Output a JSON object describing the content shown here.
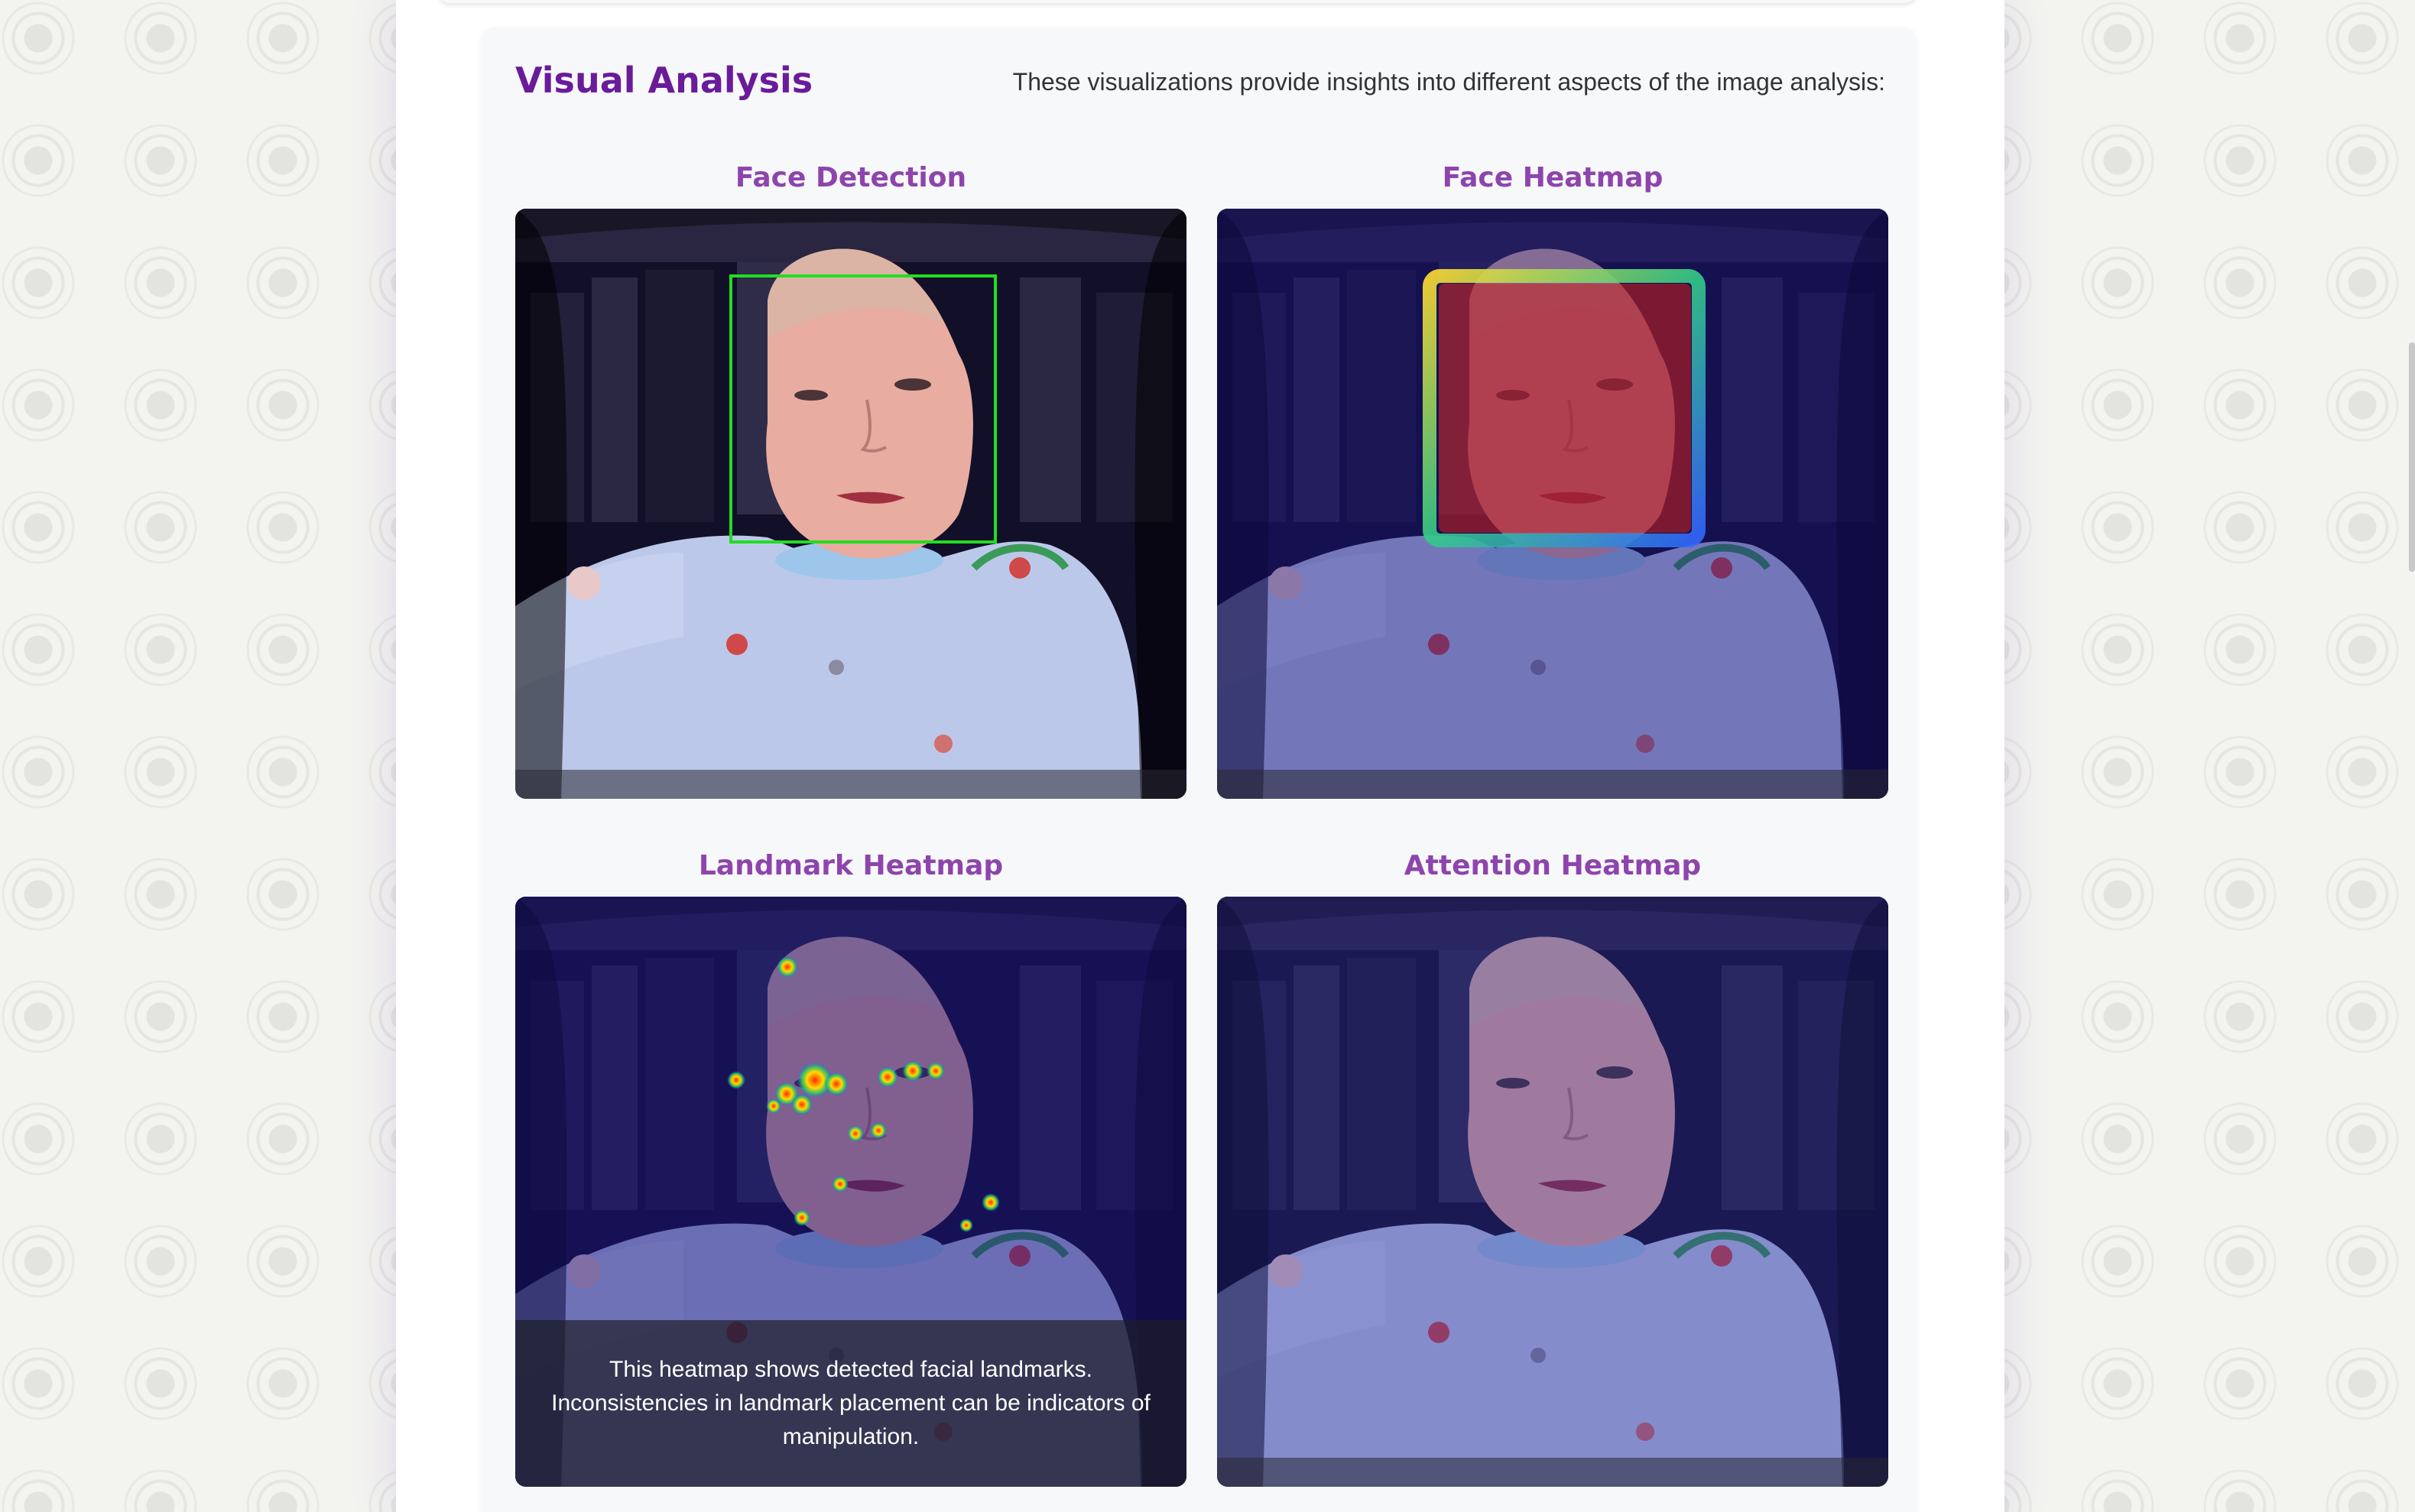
{
  "visual_analysis": {
    "title": "Visual Analysis",
    "description": "These visualizations provide insights into different aspects of the image analysis:",
    "panels": [
      {
        "title": "Face Detection"
      },
      {
        "title": "Face Heatmap"
      },
      {
        "title": "Landmark Heatmap",
        "caption": "This heatmap shows detected facial landmarks. Inconsistencies in landmark placement can be indicators of manipulation."
      },
      {
        "title": "Attention Heatmap"
      }
    ]
  },
  "colors": {
    "title": "#6a1b9a",
    "panel_title": "#8e44ad",
    "detection_box": "#22dd22"
  }
}
